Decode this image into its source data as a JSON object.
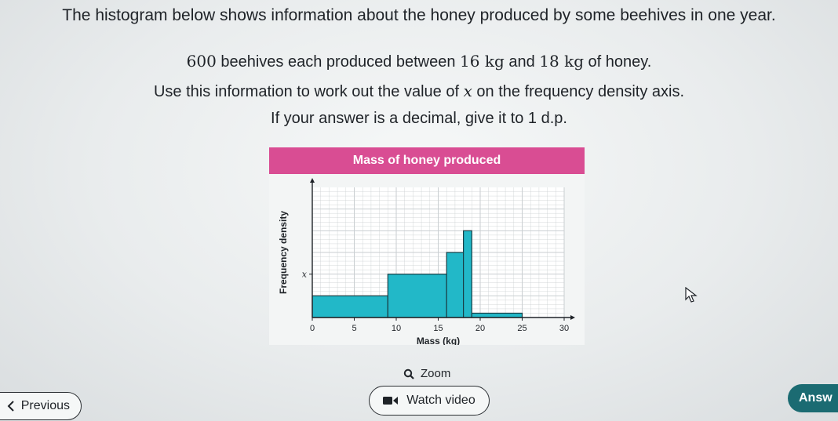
{
  "question": {
    "line1": "The histogram below shows information about the honey produced by some beehives in one year.",
    "line2_number": "600",
    "line2_a": " beehives each produced between ",
    "line2_v1": "16 kg",
    "line2_b": " and ",
    "line2_v2": "18 kg",
    "line2_c": " of honey.",
    "line3_a": "Use this information to work out the value of ",
    "line3_var": "x",
    "line3_b": " on the frequency density axis.",
    "line4": "If your answer is a decimal, give it to 1 d.p."
  },
  "figure": {
    "title": "Mass of honey produced"
  },
  "chart_data": {
    "type": "bar",
    "title": "",
    "xlabel": "Mass (kg)",
    "ylabel": "Frequency density",
    "xlim": [
      0,
      30
    ],
    "ylim": [
      0,
      6
    ],
    "xticks": [
      0,
      5,
      10,
      15,
      20,
      25,
      30
    ],
    "ytick_label": {
      "value": 2,
      "label": "x"
    },
    "bars": [
      {
        "x0": 0,
        "x1": 9,
        "height": 1.0
      },
      {
        "x0": 9,
        "x1": 16,
        "height": 2.0
      },
      {
        "x0": 16,
        "x1": 18,
        "height": 3.0
      },
      {
        "x0": 18,
        "x1": 19,
        "height": 4.0
      },
      {
        "x0": 19,
        "x1": 25,
        "height": 0.2
      }
    ],
    "grid": true,
    "bar_color": "#22b8c8"
  },
  "controls": {
    "zoom_label": "Zoom",
    "previous_label": "Previous",
    "watch_video_label": "Watch video",
    "answer_label": "Answ"
  },
  "colors": {
    "title_bar": "#d94d93",
    "answer_button": "#1b6b72"
  },
  "icons": {
    "zoom": "magnifier-icon",
    "previous": "chevron-left-icon",
    "video": "video-camera-icon",
    "cursor": "mouse-pointer-icon"
  }
}
